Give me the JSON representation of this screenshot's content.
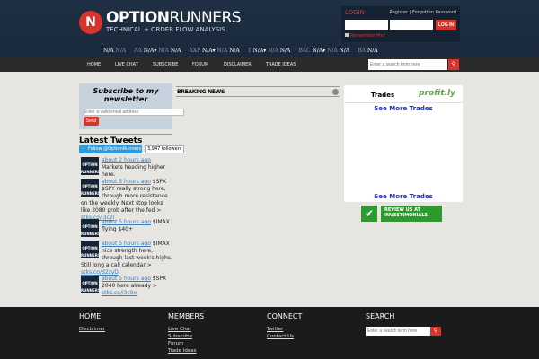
{
  "logo": {
    "brand_bold": "OPTION",
    "brand_light": "RUNNERS",
    "tagline": "TECHNICAL + ORDER FLOW ANALYSIS"
  },
  "login": {
    "title": "LOGIN",
    "register": "Register",
    "separator": "|",
    "forgot": "Forgotten Password",
    "button": "LOG IN",
    "remember": "Remember Me?"
  },
  "ticker": [
    {
      "symbol": "",
      "values": [
        "N/A",
        "N/A"
      ]
    },
    {
      "symbol": "AA",
      "values": [
        "N/A▾",
        "N/A",
        "N/A"
      ]
    },
    {
      "symbol": "AXP",
      "values": [
        "N/A▾",
        "N/A",
        "N/A"
      ]
    },
    {
      "symbol": "T",
      "values": [
        "N/A▾",
        "N/A",
        "N/A"
      ]
    },
    {
      "symbol": "BAC",
      "values": [
        "N/A▾",
        "N/A",
        "N/A"
      ]
    },
    {
      "symbol": "BA",
      "values": [
        "N/A"
      ]
    }
  ],
  "nav": {
    "items": [
      "HOME",
      "LIVE CHAT",
      "SUBSCRIBE",
      "FORUM",
      "DISCLAIMER",
      "TRADE IDEAS"
    ],
    "search_placeholder": "Enter a search term here",
    "search_icon": "magnifier-icon"
  },
  "newsletter": {
    "title": "Subscribe to my newsletter",
    "placeholder": "Enter a valid email address",
    "button": "Send"
  },
  "tweets": {
    "title": "Latest Tweets",
    "follow": "Follow @OptionRunners",
    "followers": "3,947 followers",
    "avatar": "OPTION RUNNERS",
    "items": [
      {
        "time": "about 2 hours ago",
        "text": " Markets heading higher here.",
        "link": ""
      },
      {
        "time": "about 5 hours ago",
        "text": " $SPX $SPY really strong here, through more resistance on the weekly. Next stop looks like 2080 prob after the fed > ",
        "link": "stks.co/i3c2l"
      },
      {
        "time": "about 5 hours ago",
        "text": " $IMAX flying $40+",
        "link": ""
      },
      {
        "time": "about 5 hours ago",
        "text": " $IMAX nice strength here, through last week's highs. Still long a call calendar > ",
        "link": "stks.co/d2zyD"
      },
      {
        "time": "about 5 hours ago",
        "text": " $SPX 2040 here already > ",
        "link": "stks.co/i3c9e"
      }
    ]
  },
  "breaking_news": {
    "title": "BREAKING NEWS"
  },
  "trades": {
    "title": "Trades",
    "brand": "profit.ly",
    "see_more": "See More Trades"
  },
  "review": {
    "text": "REVIEW US AT INVESTIMONIALS"
  },
  "footer": {
    "home": {
      "title": "HOME",
      "links": [
        "Disclaimer"
      ]
    },
    "members": {
      "title": "MEMBERS",
      "links": [
        "Live Chat",
        "Subscribe",
        "Forum",
        "Trade Ideas"
      ]
    },
    "connect": {
      "title": "CONNECT",
      "links": [
        "Twitter",
        "Contact Us"
      ]
    },
    "search": {
      "title": "SEARCH",
      "placeholder": "Enter a search term here"
    }
  },
  "colors": {
    "accent": "#d9342b",
    "header": "#1f3044",
    "footer": "#1b1b1b"
  }
}
